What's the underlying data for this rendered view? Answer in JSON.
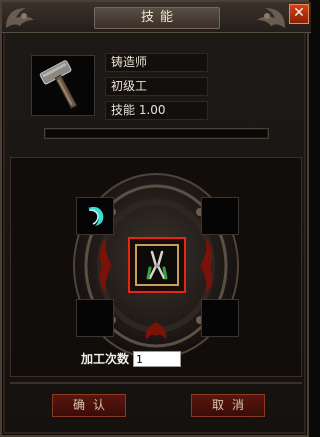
{
  "window": {
    "title": "技能",
    "close_glyph": "✕"
  },
  "skill": {
    "icon": "hammer-icon",
    "name": "铸造师",
    "rank": "初级工",
    "level_text": "技能  1.00",
    "progress_fraction": 0
  },
  "workbench": {
    "center_item_icon": "pliers-icon",
    "slot_top_left_icon": "gem-icon",
    "count_label": "加工次数",
    "count_value": "1"
  },
  "buttons": {
    "confirm_label": "确认",
    "cancel_label": "取消"
  },
  "colors": {
    "highlight": "#e52616",
    "close_button": "#c23a14",
    "gem": "#40d8d0"
  }
}
